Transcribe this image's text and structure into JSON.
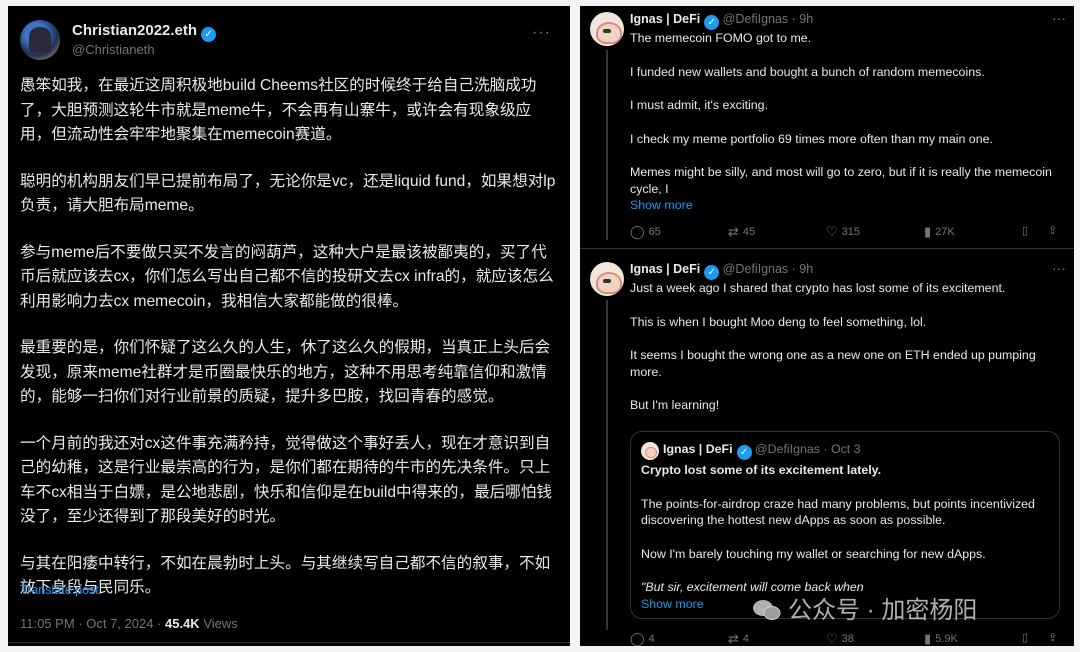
{
  "left": {
    "name": "Christian2022.eth",
    "handle": "@Christianeth",
    "paragraphs": [
      "愚笨如我，在最近这周积极地build Cheems社区的时候终于给自己洗脑成功了，大胆预测这轮牛市就是meme牛，不会再有山寨牛，或许会有现象级应用，但流动性会牢牢地聚集在memecoin赛道。",
      "聪明的机构朋友们早已提前布局了，无论你是vc，还是liquid fund，如果想对lp负责，请大胆布局meme。",
      "参与meme后不要做只买不发言的闷葫芦，这种大户是最该被鄙夷的，买了代币后就应该去cx，你们怎么写出自己都不信的投研文去cx infra的，就应该怎么利用影响力去cx memecoin，我相信大家都能做的很棒。",
      "最重要的是，你们怀疑了这么久的人生，休了这么久的假期，当真正上头后会发现，原来meme社群才是币圈最快乐的地方，这种不用思考纯靠信仰和激情的，能够一扫你们对行业前景的质疑，提升多巴胺，找回青春的感觉。",
      "一个月前的我还对cx这件事充满矜持，觉得做这个事好丢人，现在才意识到自己的幼稚，这是行业最崇高的行为，是你们都在期待的牛市的先决条件。只上车不cx相当于白嫖，是公地悲剧，快乐和信仰是在build中得来的，最后哪怕钱没了，至少还得到了那段美好的时光。",
      "与其在阳痿中转行，不如在晨勃时上头。与其继续写自己都不信的叙事，不如放下身段与民同乐。"
    ],
    "translate": "Translate post",
    "time": "11:05 PM · Oct 7, 2024 · ",
    "views_count": "45.4K",
    "views_label": " Views"
  },
  "tweet1": {
    "name": "Ignas | DeFi",
    "handle": "@DefiIgnas · 9h",
    "paragraphs": [
      "The memecoin FOMO got to me.",
      "I funded new wallets and bought a bunch of random memecoins.",
      "I must admit, it's exciting.",
      "I check my meme portfolio 69 times more often than my main one."
    ],
    "last": "Memes might be silly, and most will go to zero, but if it is really the memecoin cycle, I",
    "show_more": "Show more",
    "replies": "65",
    "reposts": "45",
    "likes": "315",
    "views": "27K"
  },
  "tweet2": {
    "name": "Ignas | DeFi",
    "handle": "@DefiIgnas · 9h",
    "paragraphs": [
      "Just a week ago I shared that crypto has lost some of its excitement.",
      "This is when I bought Moo deng to feel something, lol.",
      "It seems I bought the wrong one as a new one on ETH ended up pumping more.",
      "But I'm learning!"
    ],
    "quote": {
      "name": "Ignas | DeFi",
      "handle": "@DefiIgnas · Oct 3",
      "headline": "Crypto lost some of its excitement lately.",
      "p1": "The points-for-airdrop craze had many problems, but points incentivized discovering the hottest new dApps as soon as possible.",
      "p2": "Now I'm barely touching my wallet or searching for new dApps.",
      "p3": "\"But sir, excitement will come back when",
      "show_more": "Show more"
    },
    "replies": "4",
    "reposts": "4",
    "likes": "38",
    "views": "5.9K"
  },
  "watermark": "公众号 · 加密杨阳",
  "icons": {
    "verified": "verified-badge-icon",
    "more": "more-icon",
    "reply": "reply-icon",
    "repost": "repost-icon",
    "like": "like-icon",
    "views": "views-icon",
    "bookmark": "bookmark-icon",
    "share": "share-icon"
  },
  "colors": {
    "accent": "#1d9bf0",
    "background": "#000000",
    "muted": "#71767b"
  }
}
